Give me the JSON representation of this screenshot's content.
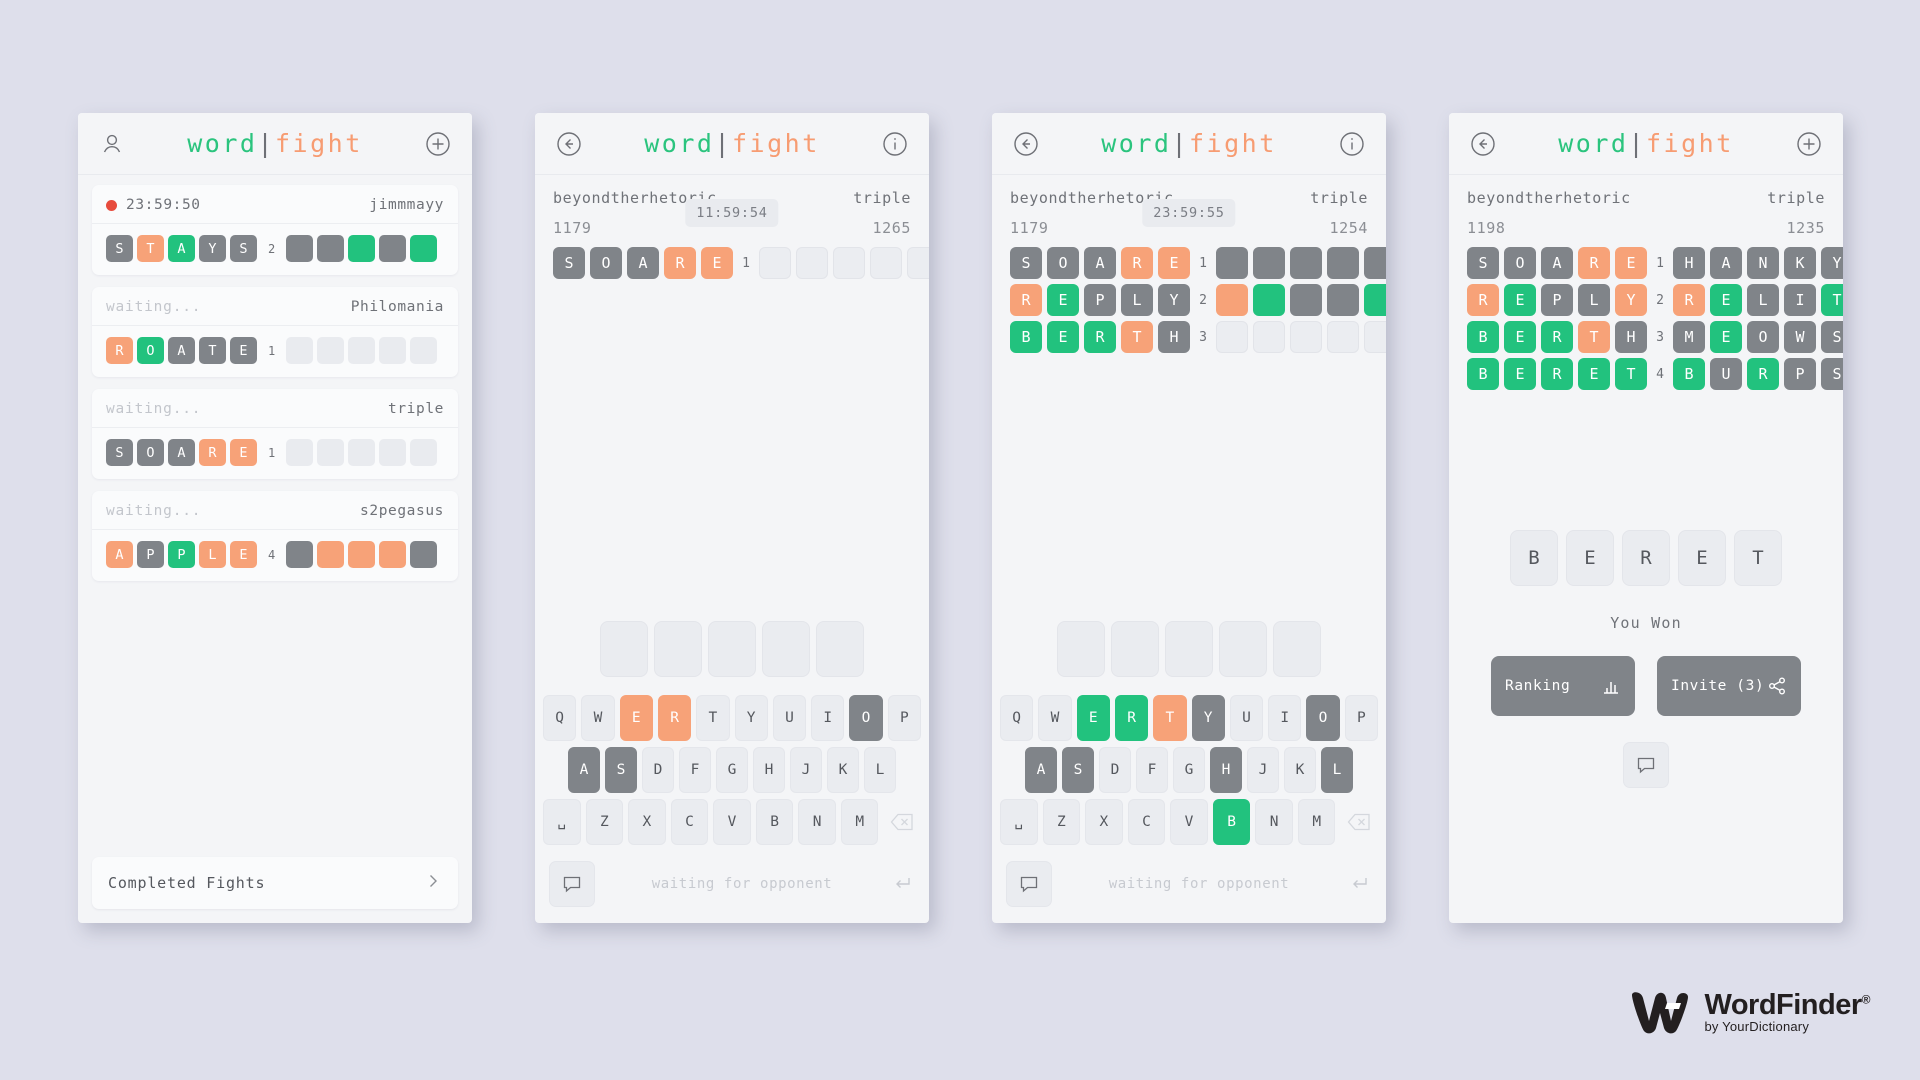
{
  "app": {
    "brand_word": "word",
    "brand_sep": "|",
    "brand_fight": "fight"
  },
  "colors": {
    "green": "#22c27e",
    "orange": "#f7a278",
    "gray": "#808489",
    "empty": "#e9ebef",
    "page_bg": "#dedfeb",
    "live_dot": "#e74b3c"
  },
  "panel1": {
    "topbar": {
      "left_icon": "profile-icon",
      "right_icon": "plus-circle-icon"
    },
    "fights": [
      {
        "status": "23:59:50",
        "live": true,
        "opponent": "jimmmayy",
        "word": [
          "S",
          "T",
          "A",
          "Y",
          "S"
        ],
        "states": [
          "gray",
          "orange",
          "green",
          "gray",
          "gray"
        ],
        "count": "2",
        "opponent_states": [
          "gray",
          "gray",
          "green",
          "gray",
          "green"
        ]
      },
      {
        "status": "waiting...",
        "live": false,
        "opponent": "Philomania",
        "word": [
          "R",
          "O",
          "A",
          "T",
          "E"
        ],
        "states": [
          "orange",
          "green",
          "gray",
          "gray",
          "gray"
        ],
        "count": "1",
        "opponent_states": [
          "empty",
          "empty",
          "empty",
          "empty",
          "empty"
        ]
      },
      {
        "status": "waiting...",
        "live": false,
        "opponent": "triple",
        "word": [
          "S",
          "O",
          "A",
          "R",
          "E"
        ],
        "states": [
          "gray",
          "gray",
          "gray",
          "orange",
          "orange"
        ],
        "count": "1",
        "opponent_states": [
          "empty",
          "empty",
          "empty",
          "empty",
          "empty"
        ]
      },
      {
        "status": "waiting...",
        "live": false,
        "opponent": "s2pegasus",
        "word": [
          "A",
          "P",
          "P",
          "L",
          "E"
        ],
        "states": [
          "orange",
          "gray",
          "green",
          "orange",
          "orange"
        ],
        "count": "4",
        "opponent_states": [
          "gray",
          "orange",
          "orange",
          "orange",
          "gray"
        ]
      }
    ],
    "completed_label": "Completed Fights",
    "completed_icon": "chevron-right-icon"
  },
  "panel2": {
    "topbar": {
      "left_icon": "back-arrow-icon",
      "right_icon": "info-circle-icon"
    },
    "player_name": "beyondtherhetoric",
    "player_score": "1179",
    "opponent_name": "triple",
    "opponent_score": "1265",
    "timer": "11:59:54",
    "rows": [
      {
        "num": "1",
        "word": [
          "S",
          "O",
          "A",
          "R",
          "E"
        ],
        "states": [
          "gray",
          "gray",
          "gray",
          "orange",
          "orange"
        ],
        "opponent_states": [
          "empty",
          "empty",
          "empty",
          "empty",
          "empty"
        ]
      }
    ],
    "slots": 5,
    "keyboard": {
      "row1": [
        {
          "k": "Q",
          "s": "none"
        },
        {
          "k": "W",
          "s": "none"
        },
        {
          "k": "E",
          "s": "orange"
        },
        {
          "k": "R",
          "s": "orange"
        },
        {
          "k": "T",
          "s": "none"
        },
        {
          "k": "Y",
          "s": "none"
        },
        {
          "k": "U",
          "s": "none"
        },
        {
          "k": "I",
          "s": "none"
        },
        {
          "k": "O",
          "s": "gray"
        },
        {
          "k": "P",
          "s": "none"
        }
      ],
      "row2": [
        {
          "k": "A",
          "s": "gray"
        },
        {
          "k": "S",
          "s": "gray"
        },
        {
          "k": "D",
          "s": "none"
        },
        {
          "k": "F",
          "s": "none"
        },
        {
          "k": "G",
          "s": "none"
        },
        {
          "k": "H",
          "s": "none"
        },
        {
          "k": "J",
          "s": "none"
        },
        {
          "k": "K",
          "s": "none"
        },
        {
          "k": "L",
          "s": "none"
        }
      ],
      "row3": [
        {
          "k": "␣",
          "s": "none"
        },
        {
          "k": "Z",
          "s": "none"
        },
        {
          "k": "X",
          "s": "none"
        },
        {
          "k": "C",
          "s": "none"
        },
        {
          "k": "V",
          "s": "none"
        },
        {
          "k": "B",
          "s": "none"
        },
        {
          "k": "N",
          "s": "none"
        },
        {
          "k": "M",
          "s": "none"
        }
      ],
      "backspace_icon": "backspace-icon"
    },
    "chat_icon": "chat-bubble-icon",
    "chat_placeholder": "waiting for opponent",
    "enter_icon": "enter-arrow-icon"
  },
  "panel3": {
    "topbar": {
      "left_icon": "back-arrow-icon",
      "right_icon": "info-circle-icon"
    },
    "player_name": "beyondtherhetoric",
    "player_score": "1179",
    "opponent_name": "triple",
    "opponent_score": "1254",
    "timer": "23:59:55",
    "rows": [
      {
        "num": "1",
        "word": [
          "S",
          "O",
          "A",
          "R",
          "E"
        ],
        "states": [
          "gray",
          "gray",
          "gray",
          "orange",
          "orange"
        ],
        "opponent_states": [
          "gray",
          "gray",
          "gray",
          "gray",
          "gray"
        ]
      },
      {
        "num": "2",
        "word": [
          "R",
          "E",
          "P",
          "L",
          "Y"
        ],
        "states": [
          "orange",
          "green",
          "gray",
          "gray",
          "gray"
        ],
        "opponent_states": [
          "orange",
          "green",
          "gray",
          "gray",
          "green"
        ]
      },
      {
        "num": "3",
        "word": [
          "B",
          "E",
          "R",
          "T",
          "H"
        ],
        "states": [
          "green",
          "green",
          "green",
          "orange",
          "gray"
        ],
        "opponent_states": [
          "empty",
          "empty",
          "empty",
          "empty",
          "empty"
        ]
      }
    ],
    "slots": 5,
    "keyboard": {
      "row1": [
        {
          "k": "Q",
          "s": "none"
        },
        {
          "k": "W",
          "s": "none"
        },
        {
          "k": "E",
          "s": "green"
        },
        {
          "k": "R",
          "s": "green"
        },
        {
          "k": "T",
          "s": "orange"
        },
        {
          "k": "Y",
          "s": "gray"
        },
        {
          "k": "U",
          "s": "none"
        },
        {
          "k": "I",
          "s": "none"
        },
        {
          "k": "O",
          "s": "gray"
        },
        {
          "k": "P",
          "s": "none"
        }
      ],
      "row2": [
        {
          "k": "A",
          "s": "gray"
        },
        {
          "k": "S",
          "s": "gray"
        },
        {
          "k": "D",
          "s": "none"
        },
        {
          "k": "F",
          "s": "none"
        },
        {
          "k": "G",
          "s": "none"
        },
        {
          "k": "H",
          "s": "gray"
        },
        {
          "k": "J",
          "s": "none"
        },
        {
          "k": "K",
          "s": "none"
        },
        {
          "k": "L",
          "s": "gray"
        }
      ],
      "row3": [
        {
          "k": "␣",
          "s": "none"
        },
        {
          "k": "Z",
          "s": "none"
        },
        {
          "k": "X",
          "s": "none"
        },
        {
          "k": "C",
          "s": "none"
        },
        {
          "k": "V",
          "s": "none"
        },
        {
          "k": "B",
          "s": "green"
        },
        {
          "k": "N",
          "s": "none"
        },
        {
          "k": "M",
          "s": "none"
        }
      ],
      "backspace_icon": "backspace-icon"
    },
    "chat_icon": "chat-bubble-icon",
    "chat_placeholder": "waiting for opponent",
    "enter_icon": "enter-arrow-icon"
  },
  "panel4": {
    "topbar": {
      "left_icon": "back-arrow-icon",
      "right_icon": "plus-circle-icon"
    },
    "player_name": "beyondtherhetoric",
    "player_score": "1198",
    "opponent_name": "triple",
    "opponent_score": "1235",
    "rows": [
      {
        "num": "1",
        "word": [
          "S",
          "O",
          "A",
          "R",
          "E"
        ],
        "states": [
          "gray",
          "gray",
          "gray",
          "orange",
          "orange"
        ],
        "opponent_word": [
          "H",
          "A",
          "N",
          "K",
          "Y"
        ],
        "opponent_states": [
          "gray",
          "gray",
          "gray",
          "gray",
          "gray"
        ]
      },
      {
        "num": "2",
        "word": [
          "R",
          "E",
          "P",
          "L",
          "Y"
        ],
        "states": [
          "orange",
          "green",
          "gray",
          "gray",
          "orange"
        ],
        "opponent_word": [
          "R",
          "E",
          "L",
          "I",
          "T"
        ],
        "opponent_states": [
          "orange",
          "green",
          "gray",
          "gray",
          "green"
        ]
      },
      {
        "num": "3",
        "word": [
          "B",
          "E",
          "R",
          "T",
          "H"
        ],
        "states": [
          "green",
          "green",
          "green",
          "orange",
          "gray"
        ],
        "opponent_word": [
          "M",
          "E",
          "O",
          "W",
          "S"
        ],
        "opponent_states": [
          "gray",
          "green",
          "gray",
          "gray",
          "gray"
        ]
      },
      {
        "num": "4",
        "word": [
          "B",
          "E",
          "R",
          "E",
          "T"
        ],
        "states": [
          "green",
          "green",
          "green",
          "green",
          "green"
        ],
        "opponent_word": [
          "B",
          "U",
          "R",
          "P",
          "S"
        ],
        "opponent_states": [
          "green",
          "gray",
          "green",
          "gray",
          "gray"
        ]
      }
    ],
    "answer_word": [
      "B",
      "E",
      "R",
      "E",
      "T"
    ],
    "result_text": "You Won",
    "ranking_label": "Ranking",
    "ranking_icon": "bar-chart-icon",
    "invite_label": "Invite (3)",
    "invite_icon": "share-icon",
    "chat_icon": "chat-bubble-icon"
  },
  "watermark": {
    "name": "WordFinder",
    "registered": "®",
    "subtitle": "by YourDictionary"
  }
}
